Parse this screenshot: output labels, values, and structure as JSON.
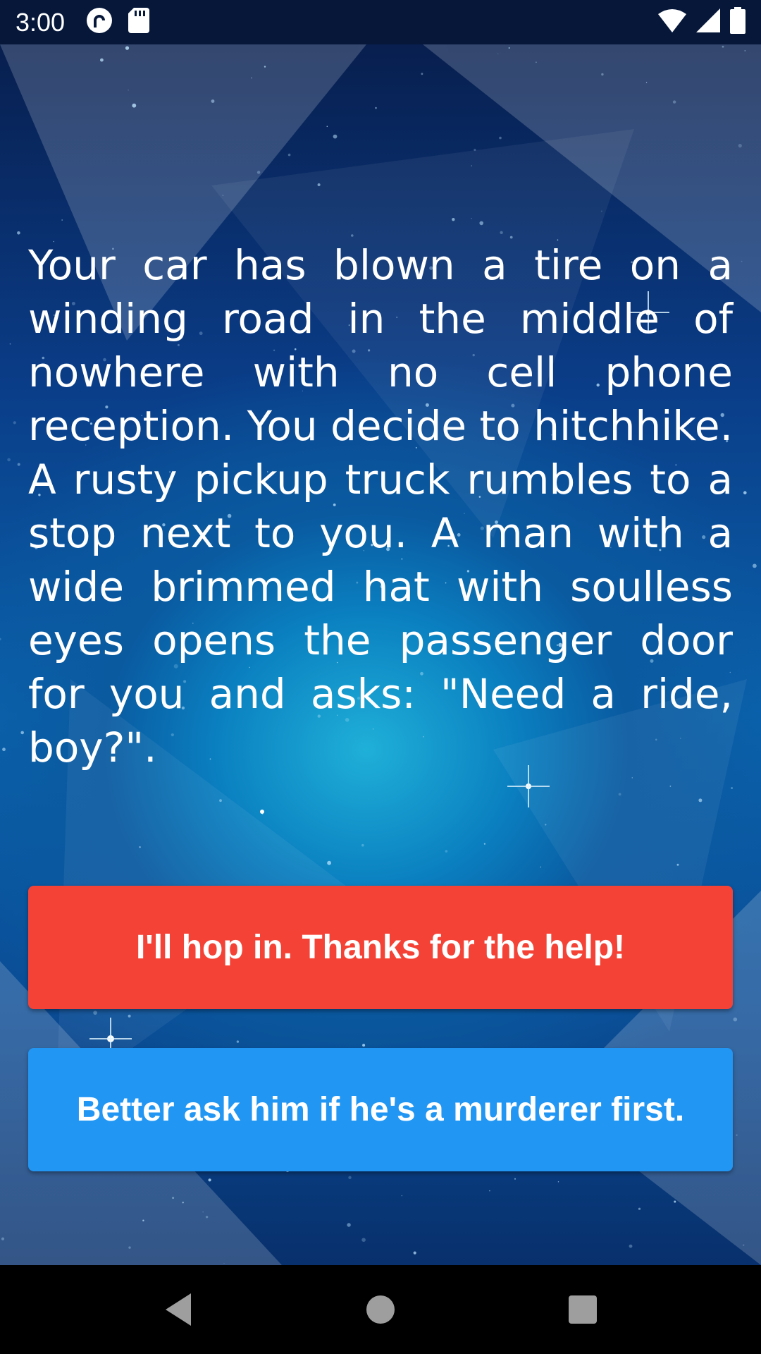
{
  "status_bar": {
    "time": "3:00",
    "icons_left": [
      "pocket-casts-icon",
      "sd-card-icon"
    ],
    "icons_right": [
      "wifi-icon",
      "cell-signal-icon",
      "battery-icon"
    ]
  },
  "story": {
    "text": "Your car has blown a tire on a winding road in the middle of nowhere with no cell phone reception. You decide to hitchhike. A rusty pickup truck rumbles to a stop next to you. A man with a wide brimmed hat with soulless eyes opens the passenger door for you and asks: \"Need a ride, boy?\"."
  },
  "choices": [
    {
      "label": "I'll hop in. Thanks for the help!",
      "color": "#f44336"
    },
    {
      "label": "Better ask him if he's a murderer first.",
      "color": "#2196f3"
    }
  ],
  "nav_bar": {
    "buttons": [
      "back-icon",
      "home-icon",
      "recents-icon"
    ]
  }
}
